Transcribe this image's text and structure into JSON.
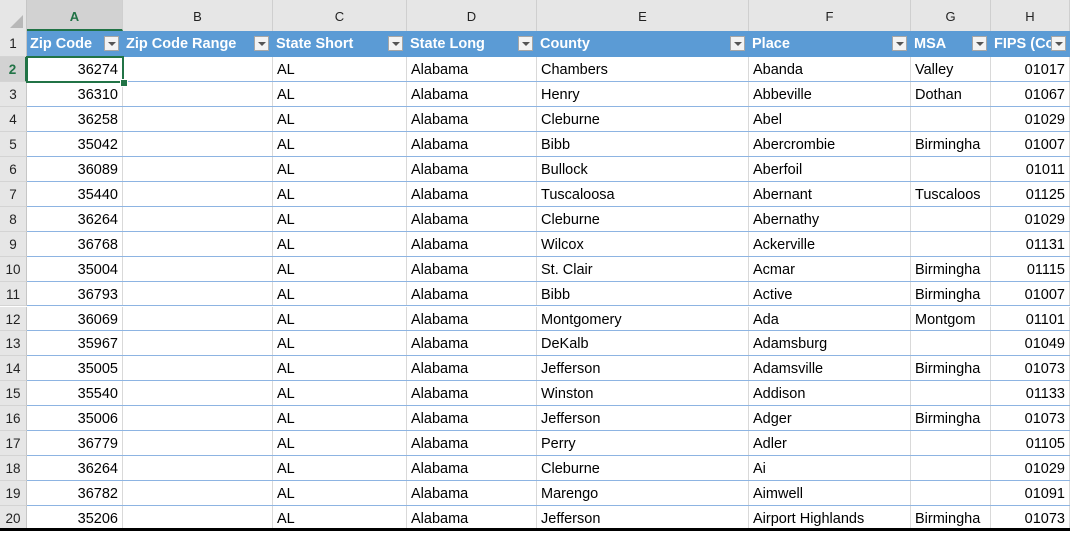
{
  "spreadsheet": {
    "active_cell": "A2",
    "column_letters": [
      "A",
      "B",
      "C",
      "D",
      "E",
      "F",
      "G",
      "H"
    ],
    "header_row_number": "1",
    "headers": [
      "Zip Code",
      "Zip Code Range",
      "State Short",
      "State Long",
      "County",
      "Place",
      "MSA",
      "FIPS (Co"
    ],
    "header_color": "#5b9bd5",
    "accent_color": "#217346",
    "rows": [
      {
        "n": "2",
        "cells": [
          "36274",
          "",
          "AL",
          "Alabama",
          "Chambers",
          "Abanda",
          "Valley",
          "01017"
        ]
      },
      {
        "n": "3",
        "cells": [
          "36310",
          "",
          "AL",
          "Alabama",
          "Henry",
          "Abbeville",
          "Dothan",
          "01067"
        ]
      },
      {
        "n": "4",
        "cells": [
          "36258",
          "",
          "AL",
          "Alabama",
          "Cleburne",
          "Abel",
          "",
          "01029"
        ]
      },
      {
        "n": "5",
        "cells": [
          "35042",
          "",
          "AL",
          "Alabama",
          "Bibb",
          "Abercrombie",
          "Birmingha",
          "01007"
        ]
      },
      {
        "n": "6",
        "cells": [
          "36089",
          "",
          "AL",
          "Alabama",
          "Bullock",
          "Aberfoil",
          "",
          "01011"
        ]
      },
      {
        "n": "7",
        "cells": [
          "35440",
          "",
          "AL",
          "Alabama",
          "Tuscaloosa",
          "Abernant",
          "Tuscaloos",
          "01125"
        ]
      },
      {
        "n": "8",
        "cells": [
          "36264",
          "",
          "AL",
          "Alabama",
          "Cleburne",
          "Abernathy",
          "",
          "01029"
        ]
      },
      {
        "n": "9",
        "cells": [
          "36768",
          "",
          "AL",
          "Alabama",
          "Wilcox",
          "Ackerville",
          "",
          "01131"
        ]
      },
      {
        "n": "10",
        "cells": [
          "35004",
          "",
          "AL",
          "Alabama",
          "St. Clair",
          "Acmar",
          "Birmingha",
          "01115"
        ]
      },
      {
        "n": "11",
        "cells": [
          "36793",
          "",
          "AL",
          "Alabama",
          "Bibb",
          "Active",
          "Birmingha",
          "01007"
        ]
      },
      {
        "n": "12",
        "cells": [
          "36069",
          "",
          "AL",
          "Alabama",
          "Montgomery",
          "Ada",
          "Montgom",
          "01101"
        ]
      },
      {
        "n": "13",
        "cells": [
          "35967",
          "",
          "AL",
          "Alabama",
          "DeKalb",
          "Adamsburg",
          "",
          "01049"
        ]
      },
      {
        "n": "14",
        "cells": [
          "35005",
          "",
          "AL",
          "Alabama",
          "Jefferson",
          "Adamsville",
          "Birmingha",
          "01073"
        ]
      },
      {
        "n": "15",
        "cells": [
          "35540",
          "",
          "AL",
          "Alabama",
          "Winston",
          "Addison",
          "",
          "01133"
        ]
      },
      {
        "n": "16",
        "cells": [
          "35006",
          "",
          "AL",
          "Alabama",
          "Jefferson",
          "Adger",
          "Birmingha",
          "01073"
        ]
      },
      {
        "n": "17",
        "cells": [
          "36779",
          "",
          "AL",
          "Alabama",
          "Perry",
          "Adler",
          "",
          "01105"
        ]
      },
      {
        "n": "18",
        "cells": [
          "36264",
          "",
          "AL",
          "Alabama",
          "Cleburne",
          "Ai",
          "",
          "01029"
        ]
      },
      {
        "n": "19",
        "cells": [
          "36782",
          "",
          "AL",
          "Alabama",
          "Marengo",
          "Aimwell",
          "",
          "01091"
        ]
      },
      {
        "n": "20",
        "cells": [
          "35206",
          "",
          "AL",
          "Alabama",
          "Jefferson",
          "Airport Highlands",
          "Birmingha",
          "01073"
        ]
      }
    ]
  }
}
